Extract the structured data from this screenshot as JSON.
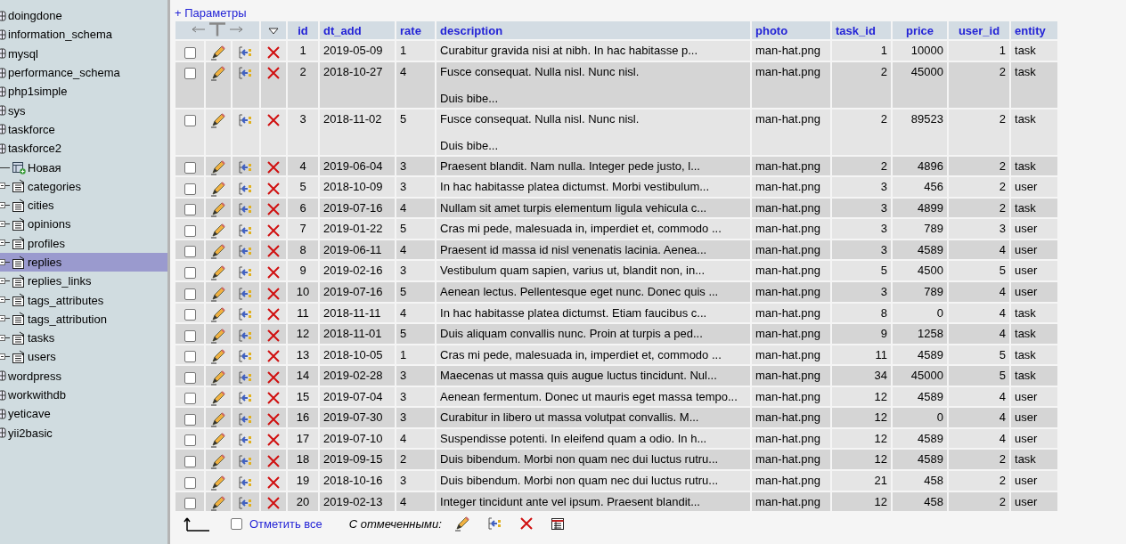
{
  "sidebar": {
    "items": [
      {
        "label": "doingdone",
        "selected": false
      },
      {
        "label": "information_schema",
        "selected": false
      },
      {
        "label": "mysql",
        "selected": false
      },
      {
        "label": "performance_schema",
        "selected": false
      },
      {
        "label": "php1simple",
        "selected": false
      },
      {
        "label": "sys",
        "selected": false
      },
      {
        "label": "taskforce",
        "selected": false
      },
      {
        "label": "taskforce2",
        "selected": false,
        "children": [
          {
            "kind": "new",
            "label": "Новая",
            "selected": false
          },
          {
            "kind": "table",
            "label": "categories",
            "selected": false
          },
          {
            "kind": "table",
            "label": "cities",
            "selected": false
          },
          {
            "kind": "table",
            "label": "opinions",
            "selected": false
          },
          {
            "kind": "table",
            "label": "profiles",
            "selected": false
          },
          {
            "kind": "table",
            "label": "replies",
            "selected": true
          },
          {
            "kind": "table",
            "label": "replies_links",
            "selected": false
          },
          {
            "kind": "table",
            "label": "tags_attributes",
            "selected": false
          },
          {
            "kind": "table",
            "label": "tags_attribution",
            "selected": false
          },
          {
            "kind": "table",
            "label": "tasks",
            "selected": false
          },
          {
            "kind": "table",
            "label": "users",
            "selected": false
          }
        ]
      },
      {
        "label": "wordpress",
        "selected": false
      },
      {
        "label": "workwithdb",
        "selected": false
      },
      {
        "label": "yeticave",
        "selected": false
      },
      {
        "label": "yii2basic",
        "selected": false
      }
    ]
  },
  "options_link": "+ Параметры",
  "table": {
    "columns": [
      "id",
      "dt_add",
      "rate",
      "description",
      "photo",
      "task_id",
      "price",
      "user_id",
      "entity"
    ],
    "rows": [
      {
        "checked": false,
        "cells": [
          "1",
          "2019-05-09",
          "1",
          [
            "Curabitur gravida nisi at nibh. In hac habitasse p..."
          ],
          "man-hat.png",
          "1",
          "10000",
          "1",
          "task"
        ]
      },
      {
        "checked": false,
        "cells": [
          "2",
          "2018-10-27",
          "4",
          [
            "Fusce consequat. Nulla nisl. Nunc nisl.",
            "Duis bibe..."
          ],
          "man-hat.png",
          "2",
          "45000",
          "2",
          "task"
        ]
      },
      {
        "checked": false,
        "cells": [
          "3",
          "2018-11-02",
          "5",
          [
            "Fusce consequat. Nulla nisl. Nunc nisl.",
            "Duis bibe..."
          ],
          "man-hat.png",
          "2",
          "89523",
          "2",
          "task"
        ]
      },
      {
        "checked": false,
        "cells": [
          "4",
          "2019-06-04",
          "3",
          [
            "Praesent blandit. Nam nulla. Integer pede justo, l..."
          ],
          "man-hat.png",
          "2",
          "4896",
          "2",
          "task"
        ]
      },
      {
        "checked": false,
        "cells": [
          "5",
          "2018-10-09",
          "3",
          [
            "In hac habitasse platea dictumst. Morbi vestibulum..."
          ],
          "man-hat.png",
          "3",
          "456",
          "2",
          "user"
        ]
      },
      {
        "checked": false,
        "cells": [
          "6",
          "2019-07-16",
          "4",
          [
            "Nullam sit amet turpis elementum ligula vehicula c..."
          ],
          "man-hat.png",
          "3",
          "4899",
          "2",
          "task"
        ]
      },
      {
        "checked": false,
        "cells": [
          "7",
          "2019-01-22",
          "5",
          [
            "Cras mi pede, malesuada in, imperdiet et, commodo ..."
          ],
          "man-hat.png",
          "3",
          "789",
          "3",
          "user"
        ]
      },
      {
        "checked": false,
        "cells": [
          "8",
          "2019-06-11",
          "4",
          [
            "Praesent id massa id nisl venenatis lacinia. Aenea..."
          ],
          "man-hat.png",
          "3",
          "4589",
          "4",
          "user"
        ]
      },
      {
        "checked": false,
        "cells": [
          "9",
          "2019-02-16",
          "3",
          [
            "Vestibulum quam sapien, varius ut, blandit non, in..."
          ],
          "man-hat.png",
          "5",
          "4500",
          "5",
          "user"
        ]
      },
      {
        "checked": false,
        "cells": [
          "10",
          "2019-07-16",
          "5",
          [
            "Aenean lectus. Pellentesque eget nunc. Donec quis ..."
          ],
          "man-hat.png",
          "3",
          "789",
          "4",
          "user"
        ]
      },
      {
        "checked": false,
        "cells": [
          "11",
          "2018-11-11",
          "4",
          [
            "In hac habitasse platea dictumst. Etiam faucibus c..."
          ],
          "man-hat.png",
          "8",
          "0",
          "4",
          "task"
        ]
      },
      {
        "checked": false,
        "cells": [
          "12",
          "2018-11-01",
          "5",
          [
            "Duis aliquam convallis nunc. Proin at turpis a ped..."
          ],
          "man-hat.png",
          "9",
          "1258",
          "4",
          "task"
        ]
      },
      {
        "checked": false,
        "cells": [
          "13",
          "2018-10-05",
          "1",
          [
            "Cras mi pede, malesuada in, imperdiet et, commodo ..."
          ],
          "man-hat.png",
          "11",
          "4589",
          "5",
          "task"
        ]
      },
      {
        "checked": false,
        "cells": [
          "14",
          "2019-02-28",
          "3",
          [
            "Maecenas ut massa quis augue luctus tincidunt. Nul..."
          ],
          "man-hat.png",
          "34",
          "45000",
          "5",
          "task"
        ]
      },
      {
        "checked": false,
        "cells": [
          "15",
          "2019-07-04",
          "3",
          [
            "Aenean fermentum. Donec ut mauris eget massa tempo..."
          ],
          "man-hat.png",
          "12",
          "4589",
          "4",
          "user"
        ]
      },
      {
        "checked": false,
        "cells": [
          "16",
          "2019-07-30",
          "3",
          [
            "Curabitur in libero ut massa volutpat convallis. M..."
          ],
          "man-hat.png",
          "12",
          "0",
          "4",
          "user"
        ]
      },
      {
        "checked": false,
        "cells": [
          "17",
          "2019-07-10",
          "4",
          [
            "Suspendisse potenti. In eleifend quam a odio. In h..."
          ],
          "man-hat.png",
          "12",
          "4589",
          "4",
          "user"
        ]
      },
      {
        "checked": false,
        "cells": [
          "18",
          "2019-09-15",
          "2",
          [
            "Duis bibendum. Morbi non quam nec dui luctus rutru..."
          ],
          "man-hat.png",
          "12",
          "4589",
          "2",
          "task"
        ]
      },
      {
        "checked": false,
        "cells": [
          "19",
          "2018-10-16",
          "3",
          [
            "Duis bibendum. Morbi non quam nec dui luctus rutru..."
          ],
          "man-hat.png",
          "21",
          "458",
          "2",
          "user"
        ]
      },
      {
        "checked": false,
        "cells": [
          "20",
          "2019-02-13",
          "4",
          [
            "Integer tincidunt ante vel ipsum. Praesent blandit..."
          ],
          "man-hat.png",
          "12",
          "458",
          "2",
          "user"
        ]
      }
    ]
  },
  "footer": {
    "check_all": {
      "label": "Отметить все",
      "checked": false
    },
    "with_selected": "С отмеченными:"
  }
}
